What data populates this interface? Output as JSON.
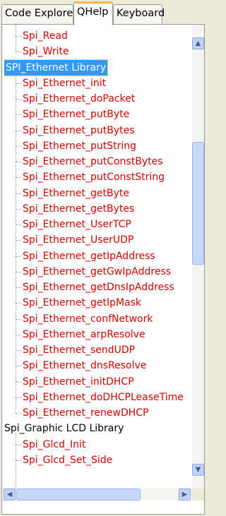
{
  "tabs": [
    "Code Explorer",
    "QHelp",
    "Keyboard"
  ],
  "tree": {
    "top_items": [
      "Spi_Read",
      "Spi_Write"
    ],
    "selected_group": "SPI_Ethernet Library",
    "ethernet_items": [
      "Spi_Ethernet_init",
      "Spi_Ethernet_doPacket",
      "Spi_Ethernet_putByte",
      "Spi_Ethernet_putBytes",
      "Spi_Ethernet_putString",
      "Spi_Ethernet_putConstBytes",
      "Spi_Ethernet_putConstString",
      "Spi_Ethernet_getByte",
      "Spi_Ethernet_getBytes",
      "Spi_Ethernet_UserTCP",
      "Spi_Ethernet_UserUDP",
      "Spi_Ethernet_getIpAddress",
      "Spi_Ethernet_getGwIpAddress",
      "Spi_Ethernet_getDnsIpAddress",
      "Spi_Ethernet_getIpMask",
      "Spi_Ethernet_confNetwork",
      "Spi_Ethernet_arpResolve",
      "Spi_Ethernet_sendUDP",
      "Spi_Ethernet_dnsResolve",
      "Spi_Ethernet_initDHCP",
      "Spi_Ethernet_doDHCPLeaseTime",
      "Spi_Ethernet_renewDHCP"
    ],
    "next_group": "Spi_Graphic LCD Library",
    "lcd_items": [
      "Spi_Glcd_Init",
      "Spi_Glcd_Set_Side"
    ]
  },
  "colors": {
    "item_text": "#d40000",
    "selection": "#3399ff",
    "active_tab_accent": "#f7b54a"
  }
}
